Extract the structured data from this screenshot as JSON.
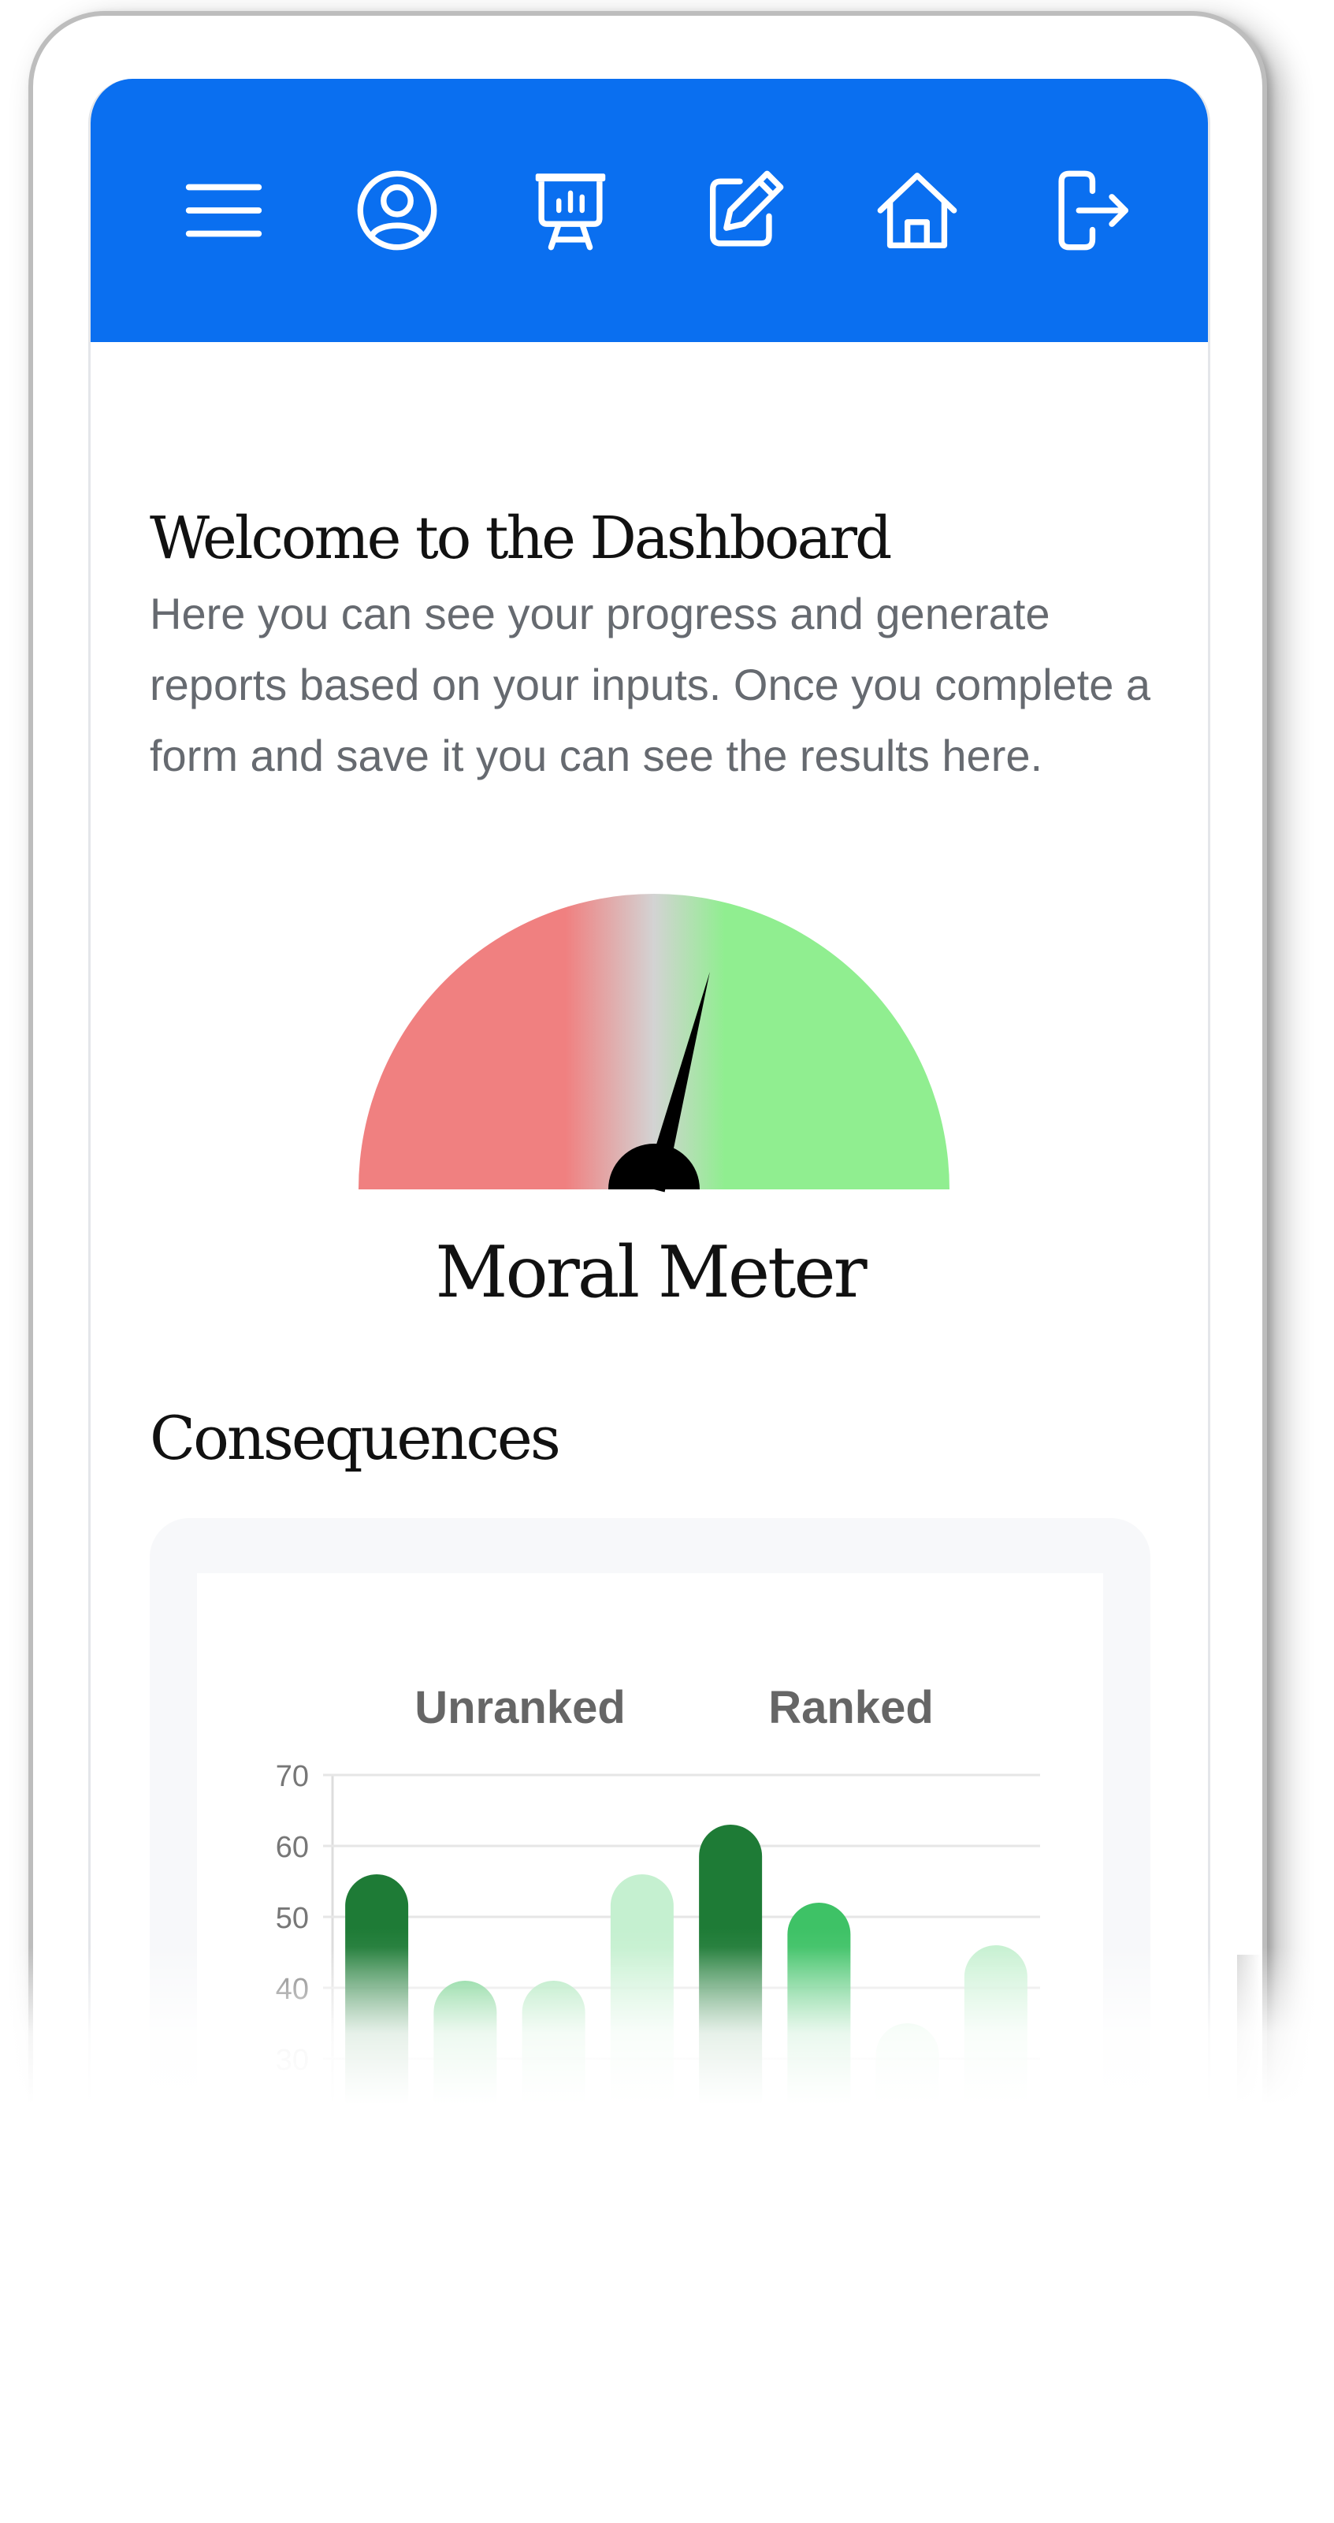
{
  "nav": {
    "items": [
      {
        "name": "menu-icon"
      },
      {
        "name": "profile-icon"
      },
      {
        "name": "presentation-chart-icon"
      },
      {
        "name": "edit-icon"
      },
      {
        "name": "home-icon"
      },
      {
        "name": "logout-icon"
      }
    ],
    "background_color": "#0a6ff0"
  },
  "welcome": {
    "title": "Welcome to the Dashboard",
    "description": "Here you can see your progress and generate reports based on your inputs. Once you complete a form and save it you can see the results here."
  },
  "meter": {
    "label": "Moral Meter",
    "value_fraction": 0.58,
    "colors": {
      "negative": "#f08080",
      "neutral": "#d3d3d3",
      "positive": "#90ee90"
    }
  },
  "consequences": {
    "title": "Consequences"
  },
  "chart_data": {
    "type": "bar",
    "legend": [
      "Unranked",
      "Ranked"
    ],
    "legend_placement": "top-center",
    "y_ticks": [
      "70",
      "60",
      "50",
      "40",
      "30"
    ],
    "ylim": [
      30,
      70
    ],
    "grid": true,
    "bars": [
      {
        "value": 56,
        "color": "#1e7b36"
      },
      {
        "value": 41,
        "color": "#5cc978"
      },
      {
        "value": 41,
        "color": "#9fe3b0"
      },
      {
        "value": 56,
        "color": "#c5f0d0"
      },
      {
        "value": 63,
        "color": "#1e7b36"
      },
      {
        "value": 52,
        "color": "#3ec266"
      },
      {
        "value": 35,
        "color": "#c5f0d0"
      },
      {
        "value": 46,
        "color": "#c5f0d0"
      }
    ]
  }
}
